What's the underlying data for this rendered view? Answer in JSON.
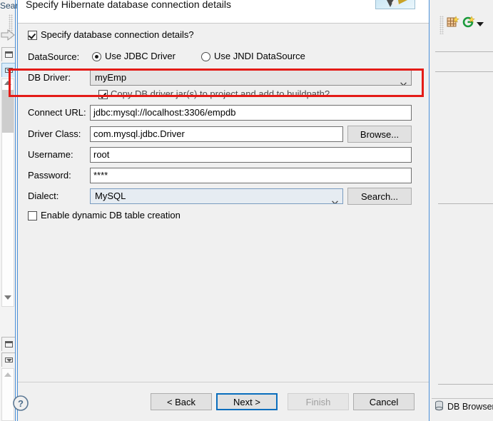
{
  "ide": {
    "search_label": "Searc",
    "db_browser_tab": "DB Browser",
    "icons": {
      "arrow_right": "arrow-right-icon",
      "grid": "table-grid-icon",
      "green_circle": "green-refresh-icon",
      "caret": "chevron-down-icon",
      "db_cylinder": "database-icon"
    }
  },
  "dialog": {
    "title": "Specify Hibernate database connection details",
    "logo_alt": "hibernate-logo",
    "specify_checkbox": {
      "label": "Specify database connection details?",
      "checked": true
    },
    "datasource": {
      "label": "DataSource:",
      "options": [
        {
          "label": "Use JDBC Driver",
          "selected": true
        },
        {
          "label": "Use JNDI DataSource",
          "selected": false
        }
      ]
    },
    "db_driver": {
      "label": "DB Driver:",
      "value": "myEmp"
    },
    "copy_jar_checkbox": {
      "label": "Copy DB driver jar(s) to project and add to buildpath?",
      "checked": true
    },
    "connect_url": {
      "label": "Connect URL:",
      "value": "jdbc:mysql://localhost:3306/empdb"
    },
    "driver_class": {
      "label": "Driver Class:",
      "value": "com.mysql.jdbc.Driver",
      "browse_button": "Browse..."
    },
    "username": {
      "label": "Username:",
      "value": "root"
    },
    "password": {
      "label": "Password:",
      "value": "****"
    },
    "dialect": {
      "label": "Dialect:",
      "value": "MySQL",
      "search_button": "Search..."
    },
    "dynamic_table_checkbox": {
      "label": "Enable dynamic DB table creation",
      "checked": false
    },
    "buttons": {
      "help": "?",
      "back": "< Back",
      "next": "Next >",
      "finish": "Finish",
      "cancel": "Cancel"
    }
  },
  "annotation": {
    "color": "#e41b17",
    "target": "db-driver-row"
  }
}
